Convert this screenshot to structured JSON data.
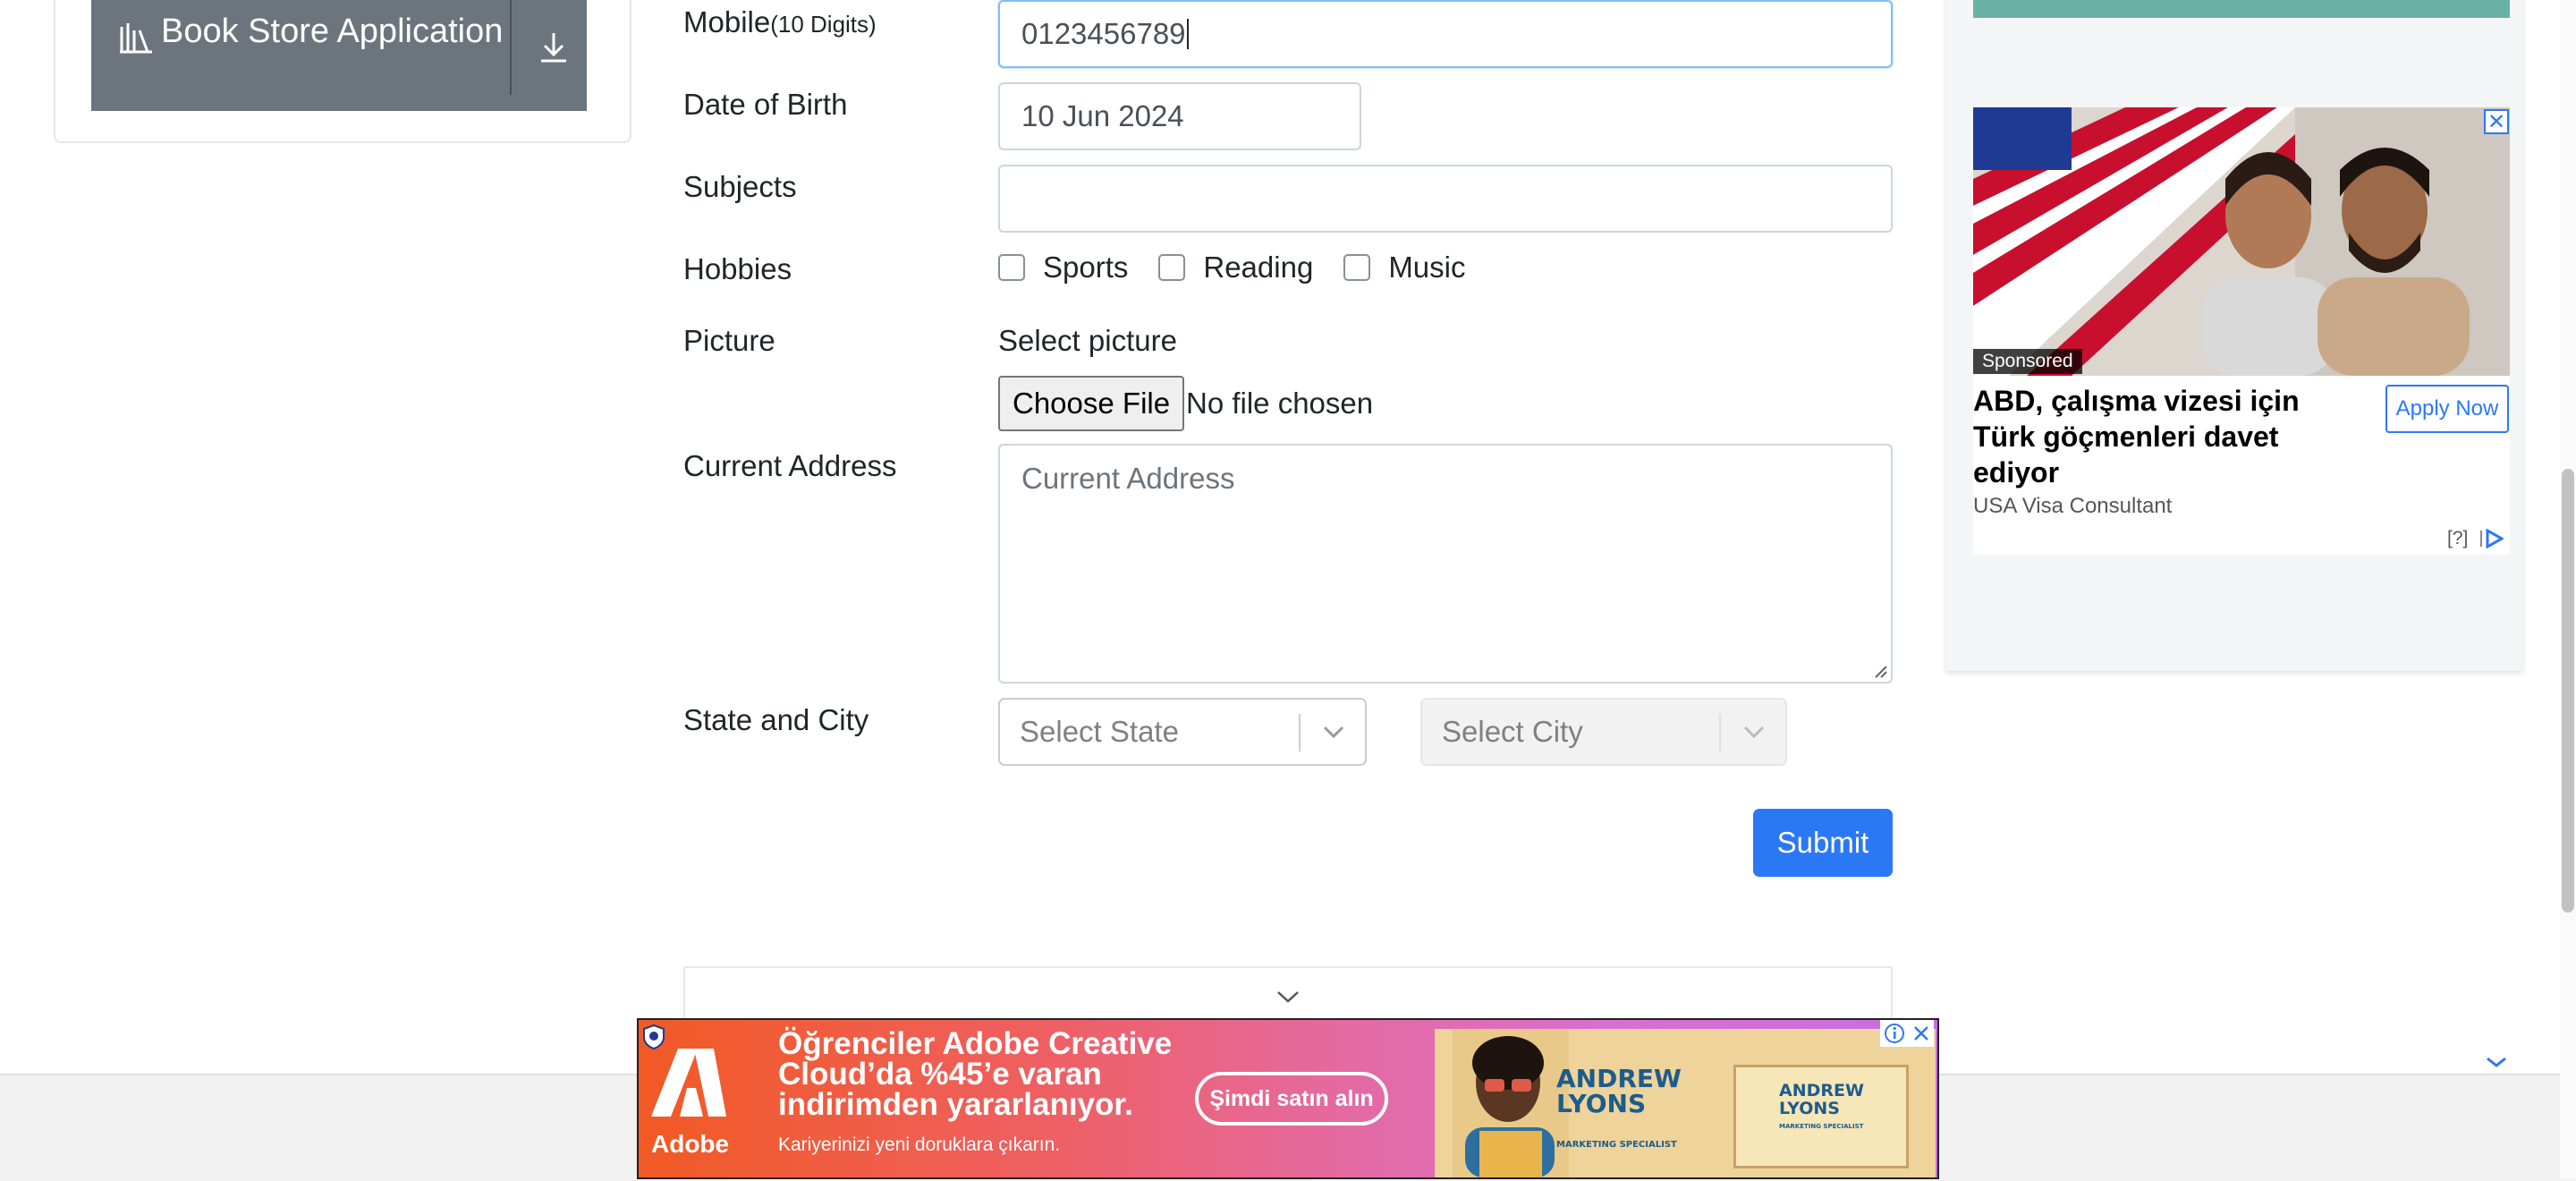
{
  "sidebar": {
    "book_store_label": "Book Store Application"
  },
  "form": {
    "mobile": {
      "label": "Mobile",
      "hint": "(10 Digits)",
      "value": "0123456789"
    },
    "dob": {
      "label": "Date of Birth",
      "value": "10 Jun 2024"
    },
    "subjects": {
      "label": "Subjects",
      "value": ""
    },
    "hobbies": {
      "label": "Hobbies",
      "options": [
        "Sports",
        "Reading",
        "Music"
      ]
    },
    "picture": {
      "label": "Picture",
      "select_label": "Select picture",
      "button_label": "Choose File",
      "status": "No file chosen"
    },
    "address": {
      "label": "Current Address",
      "placeholder": "Current Address"
    },
    "state_city": {
      "label": "State and City",
      "state_placeholder": "Select State",
      "city_placeholder": "Select City"
    },
    "submit_label": "Submit"
  },
  "side_ad": {
    "sponsored": "Sponsored",
    "headline": "ABD, çalışma vizesi için Türk göçmenleri davet ediyor",
    "advertiser": "USA Visa Consultant",
    "cta": "Apply Now",
    "info": "[?]",
    "close": "✕"
  },
  "banner_ad": {
    "brand": "Adobe",
    "headline": "Öğrenciler Adobe Creative Cloud’da %45’e varan indirimden yararlanıyor.",
    "sub": "Kariyerinizi yeni doruklara çıkarın.",
    "cta": "Şimdi satın alın",
    "promo_name_1": "ANDREW LYONS",
    "promo_title_1": "MARKETING SPECIALIST",
    "promo_name_2": "ANDREW LYONS",
    "promo_title_2": "MARKETING SPECIALIST"
  },
  "colors": {
    "primary": "#2b78f5",
    "sidebar_item": "#6c757d",
    "banner_gradient_start": "#f15a24",
    "banner_gradient_end": "#c76ee0"
  }
}
